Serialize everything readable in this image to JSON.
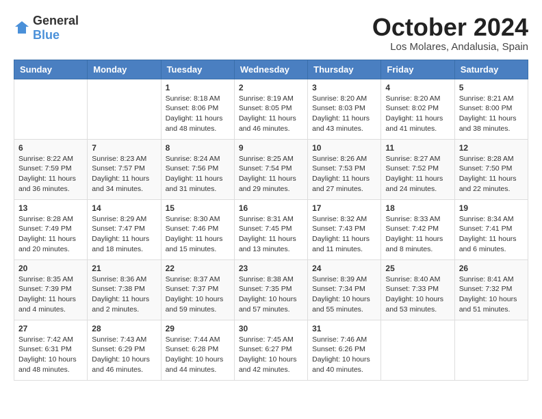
{
  "logo": {
    "text_general": "General",
    "text_blue": "Blue"
  },
  "title": "October 2024",
  "location": "Los Molares, Andalusia, Spain",
  "days_of_week": [
    "Sunday",
    "Monday",
    "Tuesday",
    "Wednesday",
    "Thursday",
    "Friday",
    "Saturday"
  ],
  "weeks": [
    [
      {
        "day": "",
        "info": ""
      },
      {
        "day": "",
        "info": ""
      },
      {
        "day": "1",
        "info": "Sunrise: 8:18 AM\nSunset: 8:06 PM\nDaylight: 11 hours and 48 minutes."
      },
      {
        "day": "2",
        "info": "Sunrise: 8:19 AM\nSunset: 8:05 PM\nDaylight: 11 hours and 46 minutes."
      },
      {
        "day": "3",
        "info": "Sunrise: 8:20 AM\nSunset: 8:03 PM\nDaylight: 11 hours and 43 minutes."
      },
      {
        "day": "4",
        "info": "Sunrise: 8:20 AM\nSunset: 8:02 PM\nDaylight: 11 hours and 41 minutes."
      },
      {
        "day": "5",
        "info": "Sunrise: 8:21 AM\nSunset: 8:00 PM\nDaylight: 11 hours and 38 minutes."
      }
    ],
    [
      {
        "day": "6",
        "info": "Sunrise: 8:22 AM\nSunset: 7:59 PM\nDaylight: 11 hours and 36 minutes."
      },
      {
        "day": "7",
        "info": "Sunrise: 8:23 AM\nSunset: 7:57 PM\nDaylight: 11 hours and 34 minutes."
      },
      {
        "day": "8",
        "info": "Sunrise: 8:24 AM\nSunset: 7:56 PM\nDaylight: 11 hours and 31 minutes."
      },
      {
        "day": "9",
        "info": "Sunrise: 8:25 AM\nSunset: 7:54 PM\nDaylight: 11 hours and 29 minutes."
      },
      {
        "day": "10",
        "info": "Sunrise: 8:26 AM\nSunset: 7:53 PM\nDaylight: 11 hours and 27 minutes."
      },
      {
        "day": "11",
        "info": "Sunrise: 8:27 AM\nSunset: 7:52 PM\nDaylight: 11 hours and 24 minutes."
      },
      {
        "day": "12",
        "info": "Sunrise: 8:28 AM\nSunset: 7:50 PM\nDaylight: 11 hours and 22 minutes."
      }
    ],
    [
      {
        "day": "13",
        "info": "Sunrise: 8:28 AM\nSunset: 7:49 PM\nDaylight: 11 hours and 20 minutes."
      },
      {
        "day": "14",
        "info": "Sunrise: 8:29 AM\nSunset: 7:47 PM\nDaylight: 11 hours and 18 minutes."
      },
      {
        "day": "15",
        "info": "Sunrise: 8:30 AM\nSunset: 7:46 PM\nDaylight: 11 hours and 15 minutes."
      },
      {
        "day": "16",
        "info": "Sunrise: 8:31 AM\nSunset: 7:45 PM\nDaylight: 11 hours and 13 minutes."
      },
      {
        "day": "17",
        "info": "Sunrise: 8:32 AM\nSunset: 7:43 PM\nDaylight: 11 hours and 11 minutes."
      },
      {
        "day": "18",
        "info": "Sunrise: 8:33 AM\nSunset: 7:42 PM\nDaylight: 11 hours and 8 minutes."
      },
      {
        "day": "19",
        "info": "Sunrise: 8:34 AM\nSunset: 7:41 PM\nDaylight: 11 hours and 6 minutes."
      }
    ],
    [
      {
        "day": "20",
        "info": "Sunrise: 8:35 AM\nSunset: 7:39 PM\nDaylight: 11 hours and 4 minutes."
      },
      {
        "day": "21",
        "info": "Sunrise: 8:36 AM\nSunset: 7:38 PM\nDaylight: 11 hours and 2 minutes."
      },
      {
        "day": "22",
        "info": "Sunrise: 8:37 AM\nSunset: 7:37 PM\nDaylight: 10 hours and 59 minutes."
      },
      {
        "day": "23",
        "info": "Sunrise: 8:38 AM\nSunset: 7:35 PM\nDaylight: 10 hours and 57 minutes."
      },
      {
        "day": "24",
        "info": "Sunrise: 8:39 AM\nSunset: 7:34 PM\nDaylight: 10 hours and 55 minutes."
      },
      {
        "day": "25",
        "info": "Sunrise: 8:40 AM\nSunset: 7:33 PM\nDaylight: 10 hours and 53 minutes."
      },
      {
        "day": "26",
        "info": "Sunrise: 8:41 AM\nSunset: 7:32 PM\nDaylight: 10 hours and 51 minutes."
      }
    ],
    [
      {
        "day": "27",
        "info": "Sunrise: 7:42 AM\nSunset: 6:31 PM\nDaylight: 10 hours and 48 minutes."
      },
      {
        "day": "28",
        "info": "Sunrise: 7:43 AM\nSunset: 6:29 PM\nDaylight: 10 hours and 46 minutes."
      },
      {
        "day": "29",
        "info": "Sunrise: 7:44 AM\nSunset: 6:28 PM\nDaylight: 10 hours and 44 minutes."
      },
      {
        "day": "30",
        "info": "Sunrise: 7:45 AM\nSunset: 6:27 PM\nDaylight: 10 hours and 42 minutes."
      },
      {
        "day": "31",
        "info": "Sunrise: 7:46 AM\nSunset: 6:26 PM\nDaylight: 10 hours and 40 minutes."
      },
      {
        "day": "",
        "info": ""
      },
      {
        "day": "",
        "info": ""
      }
    ]
  ]
}
